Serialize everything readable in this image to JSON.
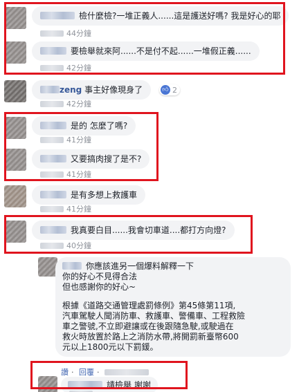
{
  "comments": [
    {
      "text": "檢什麼檢?一堆正義人......這是護送好嗎? 我是好心的耶",
      "time": "44分鐘"
    },
    {
      "text": "要檢舉就來阿......不是付不起......一堆假正義......",
      "time": "42分鐘"
    },
    {
      "name": "zeng",
      "text": "事主好像現身了",
      "likes": "2",
      "time": "42分鐘"
    },
    {
      "text": "是的 怎麼了嗎?",
      "time": "41分鐘"
    },
    {
      "text": "又要搞肉搜了是不?",
      "time": "41分鐘"
    },
    {
      "text": "是有多想上救護車",
      "time": "41分鐘"
    },
    {
      "text": "我真要白目......我會切車道....都打方向燈?",
      "time": "40分鐘"
    }
  ],
  "reply": {
    "lines": [
      "你應該進另一個爆料解釋一下",
      "你的好心不見得合法",
      "但也感謝你的好心~"
    ],
    "law_lines": [
      "根據《道路交通管理處罰條例》第45條第11項,",
      "汽車駕駛人聞消防車、救護車、警備車、工程救險",
      "車之警號,不立即避讓或在後跟隨急駛,或駛過在",
      "救火時放置於路上之消防水帶,將開罰新臺幣600",
      "元以上1800元以下罰鍰。"
    ],
    "actions": [
      "讚",
      "回覆"
    ]
  },
  "last_comment": {
    "text": "請檢舉 謝謝"
  }
}
